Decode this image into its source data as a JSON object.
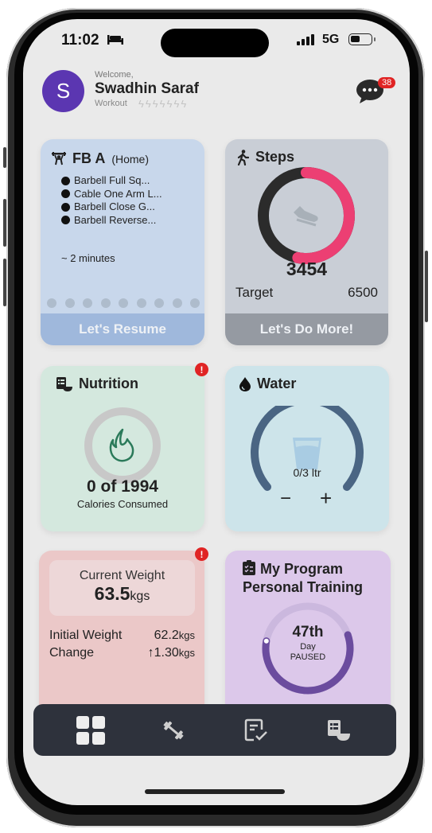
{
  "status_bar": {
    "time": "11:02",
    "network": "5G",
    "icons": [
      "bed-icon",
      "signal-icon",
      "battery-icon"
    ]
  },
  "header": {
    "avatar_initial": "S",
    "welcome": "Welcome,",
    "name": "Swadhin Saraf",
    "workout_label": "Workout",
    "workout_bolts": 7,
    "chat_badge": "38"
  },
  "workout_card": {
    "title": "FB A",
    "subtitle": "(Home)",
    "exercises": [
      "Barbell Full Sq...",
      "Cable One Arm L...",
      "Barbell Close G...",
      "Barbell Reverse..."
    ],
    "duration": "~ 2 minutes",
    "dot_count": 9,
    "button": "Let's Resume"
  },
  "steps_card": {
    "title": "Steps",
    "count": "3454",
    "target_label": "Target",
    "target_value": "6500",
    "progress": 0.531,
    "button": "Let's Do More!",
    "colors": {
      "progress": "#ec3f73",
      "track": "#2b2b2b"
    }
  },
  "nutrition_card": {
    "title": "Nutrition",
    "calories": "0 of 1994",
    "label": "Calories Consumed",
    "alert": "!",
    "progress": 0
  },
  "water_card": {
    "title": "Water",
    "value": "0/3 ltr",
    "minus": "−",
    "plus": "+",
    "progress": 0
  },
  "weight_card": {
    "current_label": "Current Weight",
    "current_value": "63.5",
    "unit": "kgs",
    "initial_label": "Initial Weight",
    "initial_value": "62.2",
    "change_label": "Change",
    "change_value": "↑1.30",
    "alert": "!"
  },
  "program_card": {
    "title_line1": "My Program",
    "title_line2": "Personal Training",
    "day": "47th",
    "day_label": "Day",
    "status": "PAUSED",
    "progress": 0.58
  },
  "tab_bar": {
    "tabs": [
      {
        "name": "dashboard",
        "icon": "grid-icon",
        "active": true
      },
      {
        "name": "workout",
        "icon": "dumbbell-icon",
        "active": false
      },
      {
        "name": "program",
        "icon": "checklist-icon",
        "active": false
      },
      {
        "name": "nutrition",
        "icon": "nutrition-icon",
        "active": false
      }
    ]
  }
}
